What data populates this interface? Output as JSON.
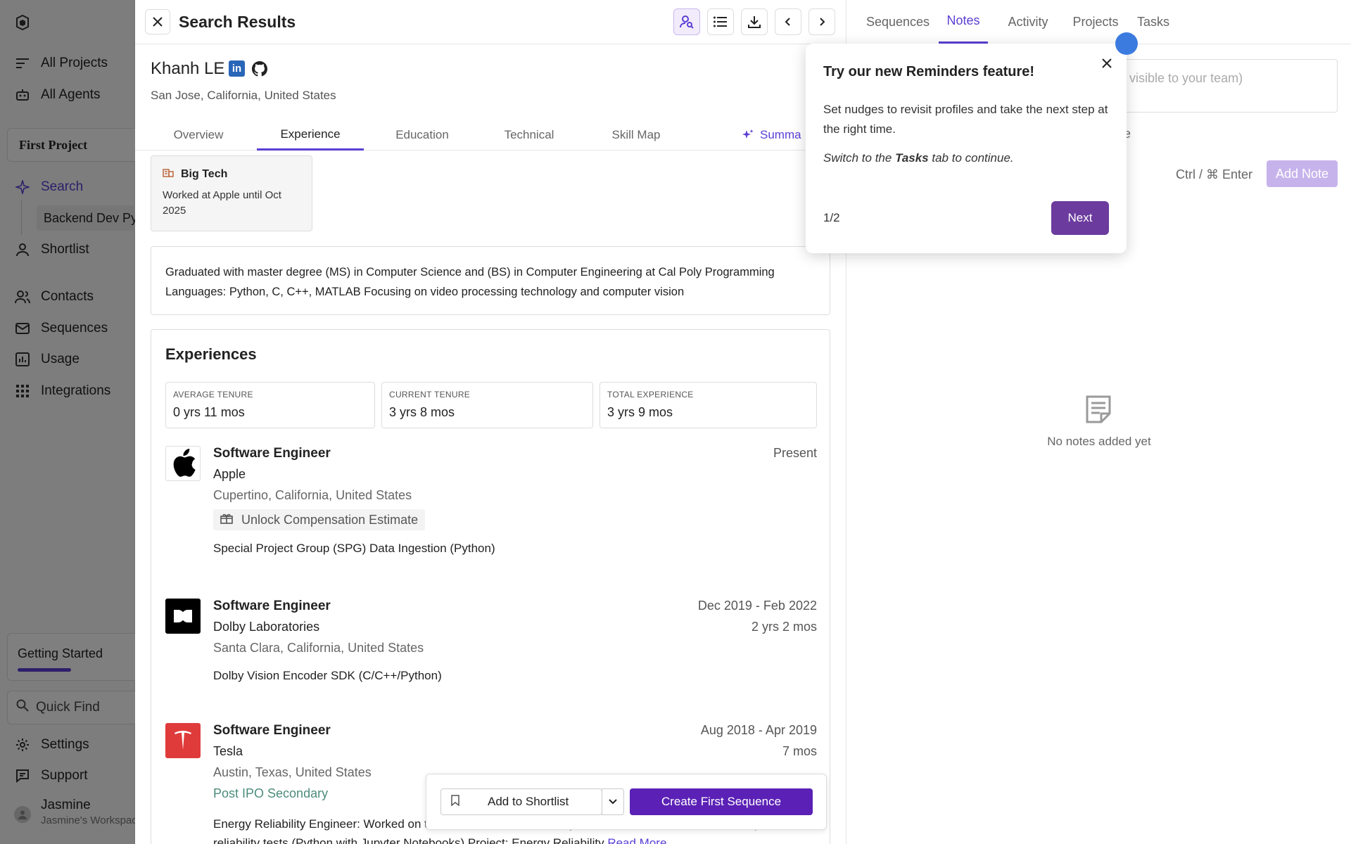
{
  "sidebar": {
    "nav_top": [
      {
        "label": "All Projects",
        "icon": "list-icon"
      },
      {
        "label": "All Agents",
        "icon": "robot-icon"
      }
    ],
    "project_name": "First Project",
    "search_label": "Search",
    "sub_item": "Backend Dev Py",
    "shortlist_label": "Shortlist",
    "nav_mid": [
      {
        "label": "Contacts",
        "icon": "contacts-icon"
      },
      {
        "label": "Sequences",
        "icon": "mail-icon"
      },
      {
        "label": "Usage",
        "icon": "chart-icon"
      },
      {
        "label": "Integrations",
        "icon": "grid-icon"
      }
    ],
    "getting_started": "Getting Started",
    "getting_started_progress": 0.38,
    "quick_find": "Quick Find",
    "settings": "Settings",
    "support": "Support",
    "user_name": "Jasmine",
    "workspace": "Jasmine's Workspace"
  },
  "main": {
    "title": "Search Results",
    "profile": {
      "name": "Khanh LE",
      "location": "San Jose, California, United States"
    },
    "tabs": [
      "Overview",
      "Experience",
      "Education",
      "Technical",
      "Skill Map",
      "Summa"
    ],
    "active_tab": "Experience",
    "big_tech": {
      "label": "Big Tech",
      "detail": "Worked at Apple until Oct 2025"
    },
    "summary": "Graduated with master degree (MS) in Computer Science and (BS) in Computer Engineering at Cal Poly Programming Languages: Python, C, C++, MATLAB Focusing on video processing technology and computer vision",
    "experiences_title": "Experiences",
    "stats": [
      {
        "label": "AVERAGE TENURE",
        "value": "0 yrs 11 mos"
      },
      {
        "label": "CURRENT TENURE",
        "value": "3 yrs 8 mos"
      },
      {
        "label": "TOTAL EXPERIENCE",
        "value": "3 yrs 9 mos"
      }
    ],
    "jobs": [
      {
        "title": "Software Engineer",
        "company": "Apple",
        "location": "Cupertino, California, United States",
        "date": "Present",
        "unlock": "Unlock Compensation Estimate",
        "desc": "Special Project Group (SPG) Data Ingestion (Python)"
      },
      {
        "title": "Software Engineer",
        "company": "Dolby Laboratories",
        "location": "Santa Clara, California, United States",
        "date": "Dec 2019 - Feb 2022",
        "duration": "2 yrs 2 mos",
        "desc": "Dolby Vision Encoder SDK (C/C++/Python)"
      },
      {
        "title": "Software Engineer",
        "company": "Tesla",
        "location": "Austin, Texas, United States",
        "date": "Aug 2018 - Apr 2019",
        "duration": "7 mos",
        "link": "Post IPO Secondary",
        "desc": "Energy Reliability Engineer: Worked on the automation of data analysis and data visualization for multiple reliability tests (Python with Jupyter Notebooks) Project: Energy Reliability",
        "read_more": "Read More"
      }
    ],
    "actions": {
      "shortlist": "Add to Shortlist",
      "sequence": "Create First Sequence"
    }
  },
  "right": {
    "tabs": [
      "Sequences",
      "Notes",
      "Activity",
      "Projects",
      "Tasks"
    ],
    "active_tab": "Notes",
    "note_placeholder": "(will be visible to your team)",
    "share_fragment": "re",
    "shortcut": "Ctrl / ⌘ Enter",
    "add_note": "Add Note",
    "empty": "No notes added yet"
  },
  "popover": {
    "title": "Try our new Reminders feature!",
    "body": "Set nudges to revisit profiles and take the next step at the right time.",
    "italic_pre": "Switch to the ",
    "italic_bold": "Tasks",
    "italic_post": " tab to continue.",
    "step": "1/2",
    "next": "Next"
  },
  "colors": {
    "accent": "#5b3fd4",
    "primary_button": "#5b21b6",
    "next_button": "#6b3b9e",
    "beacon": "#3b7be0"
  }
}
